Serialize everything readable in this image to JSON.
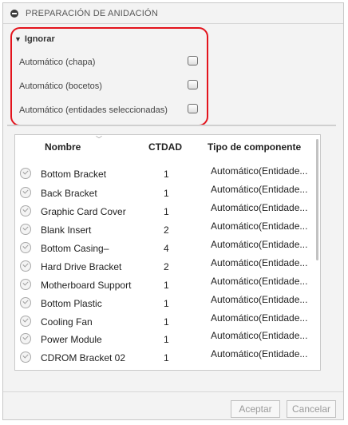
{
  "header": {
    "title": "PREPARACIÓN DE ANIDACIÓN",
    "collapse_icon": "minus-circle-icon"
  },
  "ignore_group": {
    "title": "Ignorar",
    "options": [
      {
        "label": "Automático (chapa)",
        "checked": false
      },
      {
        "label": "Automático (bocetos)",
        "checked": false
      },
      {
        "label": "Automático (entidades seleccionadas)",
        "checked": false
      }
    ]
  },
  "table": {
    "columns": {
      "name": "Nombre",
      "qty": "CTDAD",
      "type": "Tipo de componente"
    },
    "rows": [
      {
        "name": "Bottom Bracket",
        "qty": "1",
        "type": "Automático(Entidade..."
      },
      {
        "name": "Back Bracket",
        "qty": "1",
        "type": "Automático(Entidade..."
      },
      {
        "name": "Graphic Card Cover",
        "qty": "1",
        "type": "Automático(Entidade..."
      },
      {
        "name": "Blank Insert",
        "qty": "2",
        "type": "Automático(Entidade..."
      },
      {
        "name": "Bottom Casing–",
        "qty": "4",
        "type": "Automático(Entidade..."
      },
      {
        "name": "Hard Drive Bracket",
        "qty": "2",
        "type": "Automático(Entidade..."
      },
      {
        "name": "Motherboard Support",
        "qty": "1",
        "type": "Automático(Entidade..."
      },
      {
        "name": "Bottom Plastic",
        "qty": "1",
        "type": "Automático(Entidade..."
      },
      {
        "name": "Cooling Fan",
        "qty": "1",
        "type": "Automático(Entidade..."
      },
      {
        "name": "Power Module",
        "qty": "1",
        "type": "Automático(Entidade..."
      },
      {
        "name": "CDROM Bracket 02",
        "qty": "1",
        "type": "Automático(Entidade..."
      }
    ]
  },
  "buttons": {
    "accept": "Aceptar",
    "cancel": "Cancelar"
  },
  "colors": {
    "highlight": "#e3131c",
    "panel_bg": "#f3f3f3"
  }
}
